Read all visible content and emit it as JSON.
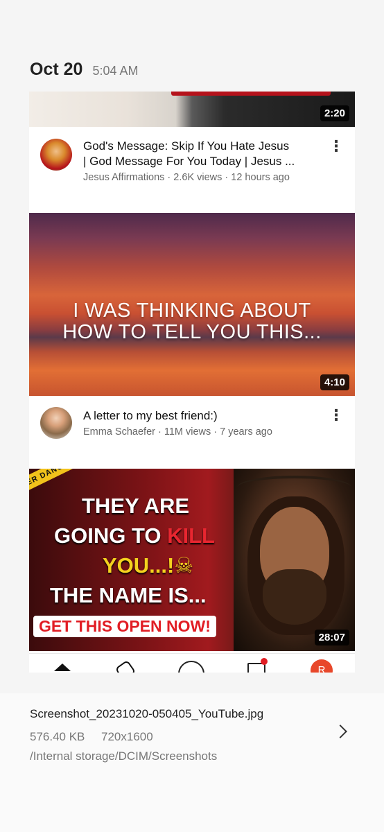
{
  "header": {
    "date": "Oct 20",
    "time": "5:04 AM"
  },
  "videos": [
    {
      "duration": "2:20",
      "title_line1": "God's Message: Skip If You Hate Jesus",
      "title_line2": "| God Message For You Today | Jesus ...",
      "channel_meta": "Jesus Affirmations · 2.6K views · 12 hours ago"
    },
    {
      "thumb_line1": "I WAS THINKING ABOUT",
      "thumb_line2": "HOW TO TELL YOU THIS...",
      "duration": "4:10",
      "title": "A letter to my best friend:)",
      "channel_meta": "Emma Schaefer · 11M views · 7 years ago"
    },
    {
      "tape": "DANGER   DANGER   DA",
      "line1": "THEY ARE",
      "line2a": "GOING TO ",
      "line2b": "KILL",
      "line3": "YOU...!☠",
      "line4": "THE NAME IS...",
      "cta": "GET THIS OPEN NOW!",
      "duration": "28:07"
    }
  ],
  "bottom_nav": {
    "profile_initial": "R"
  },
  "file": {
    "name": "Screenshot_20231020-050405_YouTube.jpg",
    "size": "576.40 KB",
    "dimensions": "720x1600",
    "path": "/Internal storage/DCIM/Screenshots"
  }
}
